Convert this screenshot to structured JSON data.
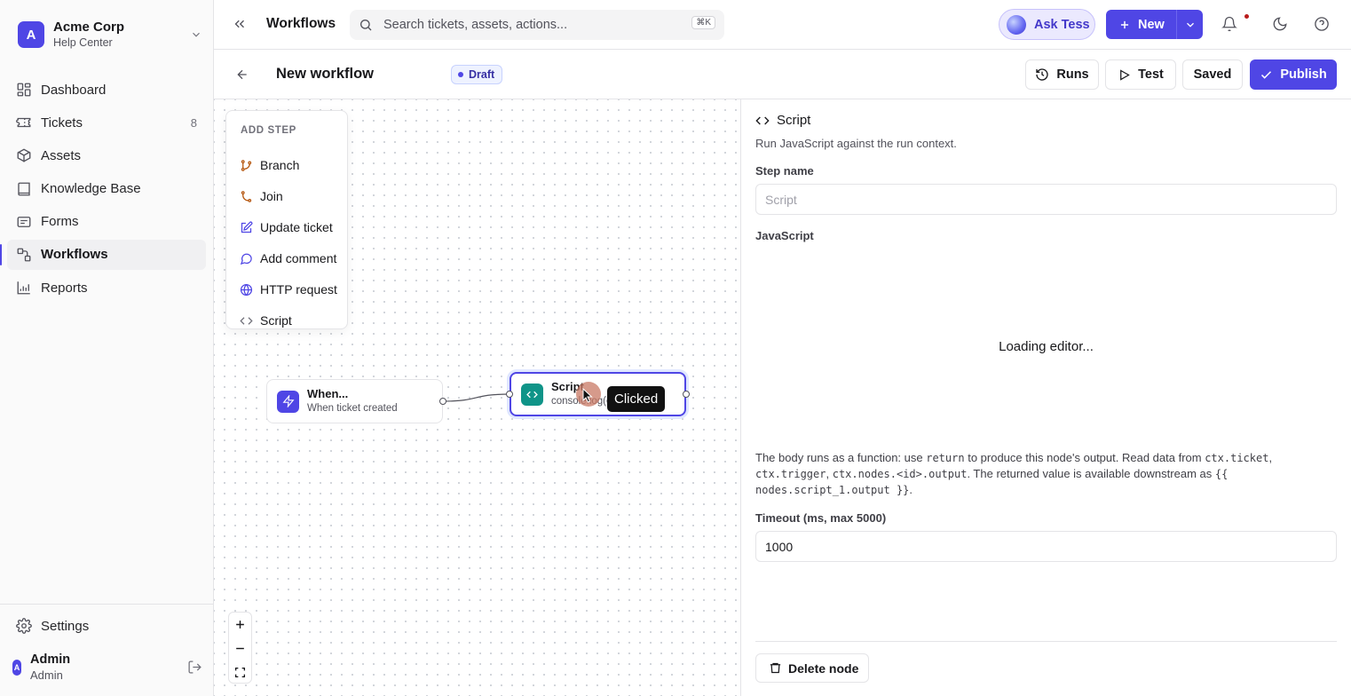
{
  "sidebar": {
    "org": {
      "initial": "A",
      "name": "Acme Corp",
      "subtitle": "Help Center"
    },
    "items": [
      {
        "label": "Dashboard",
        "icon": "grid-icon"
      },
      {
        "label": "Tickets",
        "icon": "ticket-icon",
        "count": "8"
      },
      {
        "label": "Assets",
        "icon": "box-icon"
      },
      {
        "label": "Knowledge Base",
        "icon": "book-icon"
      },
      {
        "label": "Forms",
        "icon": "form-icon"
      },
      {
        "label": "Workflows",
        "icon": "workflow-icon",
        "active": true
      },
      {
        "label": "Reports",
        "icon": "chart-icon"
      }
    ],
    "settings_label": "Settings",
    "user": {
      "initial": "A",
      "name": "Admin",
      "role": "Admin"
    }
  },
  "topbar": {
    "title": "Workflows",
    "search_placeholder": "Search tickets, assets, actions...",
    "search_shortcut": "⌘K",
    "ask_label": "Ask Tess",
    "new_label": "New"
  },
  "workflow": {
    "title": "New workflow",
    "status": "Draft",
    "runs_label": "Runs",
    "test_label": "Test",
    "saved_label": "Saved",
    "publish_label": "Publish"
  },
  "add_menu": {
    "heading": "ADD STEP",
    "items": [
      {
        "label": "Branch",
        "icon": "branch-icon"
      },
      {
        "label": "Join",
        "icon": "join-icon"
      },
      {
        "label": "Update ticket",
        "icon": "edit-icon"
      },
      {
        "label": "Add comment",
        "icon": "comment-icon"
      },
      {
        "label": "HTTP request",
        "icon": "globe-icon"
      },
      {
        "label": "Script",
        "icon": "code-icon"
      }
    ]
  },
  "nodes": {
    "trigger": {
      "title": "When...",
      "subtitle": "When ticket created"
    },
    "script": {
      "title": "Script",
      "subtitle": "console.log(ctx)"
    }
  },
  "tooltip": "Clicked",
  "panel": {
    "title": "Script",
    "description": "Run JavaScript against the run context.",
    "step_name_label": "Step name",
    "step_name_placeholder": "Script",
    "js_label": "JavaScript",
    "editor_loading": "Loading editor...",
    "help": {
      "p1": "The body runs as a function: use ",
      "c1": "return",
      "p2": " to produce this node's output. Read data from ",
      "c2": "ctx.ticket",
      "p3": ", ",
      "c3": "ctx.trigger",
      "p4": ", ",
      "c4": "ctx.nodes.<id>.output",
      "p5": ". The returned value is available downstream as ",
      "c5": "{{ nodes.script_1.output }}",
      "p6": "."
    },
    "timeout_label": "Timeout (ms, max 5000)",
    "timeout_value": "1000",
    "delete_label": "Delete node"
  },
  "colors": {
    "accent": "#4f46e5",
    "script_node": "#0f9488"
  }
}
